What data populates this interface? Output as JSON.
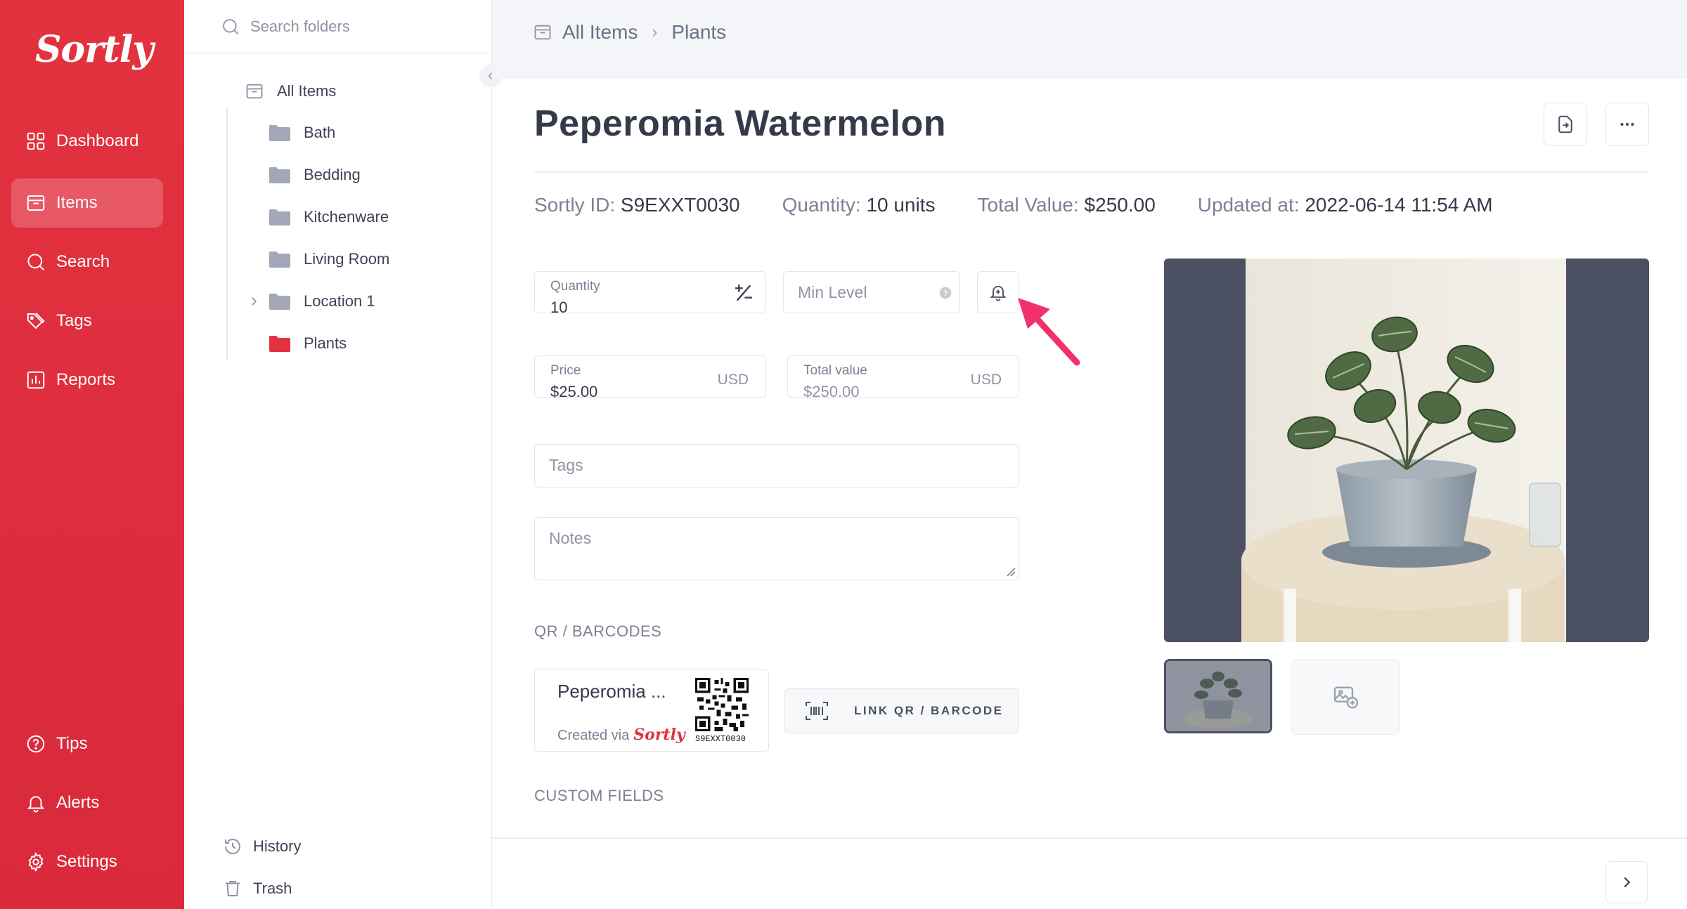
{
  "brand": {
    "logo_text": "Sortly",
    "color": "#e3323f"
  },
  "nav": {
    "items": [
      {
        "label": "Dashboard",
        "icon": "dashboard-icon"
      },
      {
        "label": "Items",
        "icon": "items-icon",
        "active": true
      },
      {
        "label": "Search",
        "icon": "search-icon"
      },
      {
        "label": "Tags",
        "icon": "tags-icon"
      },
      {
        "label": "Reports",
        "icon": "reports-icon"
      }
    ],
    "bottom_items": [
      {
        "label": "Tips",
        "icon": "help-icon"
      },
      {
        "label": "Alerts",
        "icon": "bell-icon"
      },
      {
        "label": "Settings",
        "icon": "gear-icon"
      }
    ]
  },
  "folders": {
    "search_placeholder": "Search folders",
    "root": "All Items",
    "items": [
      {
        "label": "Bath"
      },
      {
        "label": "Bedding"
      },
      {
        "label": "Kitchenware"
      },
      {
        "label": "Living Room"
      },
      {
        "label": "Location 1",
        "expandable": true
      },
      {
        "label": "Plants",
        "active": true
      }
    ],
    "history_label": "History",
    "trash_label": "Trash"
  },
  "breadcrumb": {
    "root": "All Items",
    "current": "Plants"
  },
  "item": {
    "title": "Peperomia Watermelon",
    "sortly_id_label": "Sortly ID:",
    "sortly_id": "S9EXXT0030",
    "quantity_label": "Quantity:",
    "quantity_text": "10 units",
    "total_value_label": "Total Value:",
    "total_value_text": "$250.00",
    "updated_label": "Updated at:",
    "updated_text": "2022-06-14 11:54 AM"
  },
  "form": {
    "quantity": {
      "label": "Quantity",
      "value": "10"
    },
    "min_level": {
      "placeholder": "Min Level"
    },
    "price": {
      "label": "Price",
      "value": "$25.00",
      "suffix": "USD"
    },
    "total_value": {
      "label": "Total value",
      "value": "$250.00",
      "suffix": "USD"
    },
    "tags_placeholder": "Tags",
    "notes_placeholder": "Notes"
  },
  "qr_section": {
    "heading": "QR / BARCODES",
    "card_name": "Peperomia ...",
    "created_via": "Created via",
    "created_via_brand": "Sortly",
    "code_id": "S9EXXT0030",
    "link_button": "LINK QR / BARCODE"
  },
  "custom_fields_heading": "CUSTOM FIELDS",
  "colors": {
    "annotation_arrow": "#f2316b",
    "photo_backdrop": "#4b5163",
    "nav_bg": "#e3323f"
  }
}
